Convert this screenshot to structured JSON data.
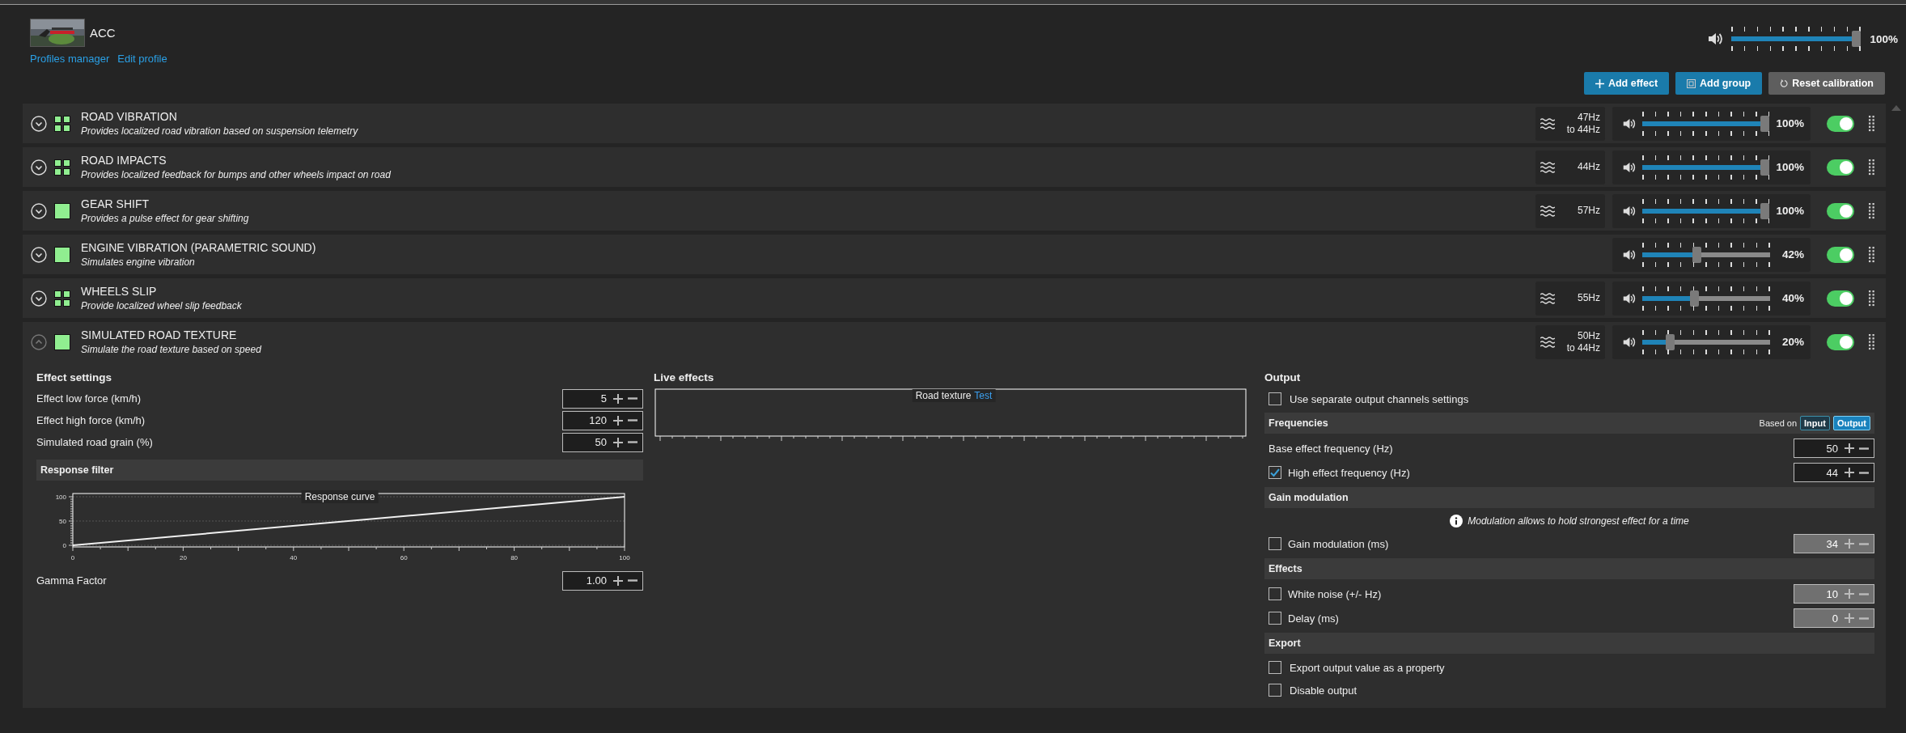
{
  "profile": {
    "thumbnail": {
      "kind": "picture"
    },
    "name": "ACC",
    "links": [
      "Profiles manager",
      "Edit profile"
    ]
  },
  "master_volume": {
    "level": 1.0,
    "reading": "100%"
  },
  "toolbar": [
    {
      "kind": "add",
      "label": "Add effect"
    },
    {
      "kind": "group",
      "label": "Add group"
    },
    {
      "kind": "reset",
      "label": "Reset calibration"
    }
  ],
  "effects": [
    {
      "kind": "group",
      "title": "ROAD VIBRATION",
      "description": "Provides localized road vibration based on suspension telemetry",
      "expanded": false,
      "frequency": [
        "47Hz",
        "to 44Hz"
      ],
      "level": 1.0,
      "reading": "100%",
      "on": true
    },
    {
      "kind": "group",
      "title": "ROAD IMPACTS",
      "description": "Provides localized feedback for bumps and other wheels impact on road",
      "expanded": false,
      "frequency": [
        "44Hz"
      ],
      "level": 1.0,
      "reading": "100%",
      "on": true
    },
    {
      "kind": "single",
      "title": "GEAR SHIFT",
      "description": "Provides a pulse effect for gear shifting",
      "expanded": false,
      "frequency": [
        "57Hz"
      ],
      "level": 1.0,
      "reading": "100%",
      "on": true
    },
    {
      "kind": "single",
      "title": "ENGINE VIBRATION (PARAMETRIC SOUND)",
      "description": "Simulates engine vibration",
      "expanded": false,
      "level": 0.42,
      "reading": "42%",
      "on": true
    },
    {
      "kind": "group",
      "title": "WHEELS SLIP",
      "description": "Provide localized wheel slip feedback",
      "expanded": false,
      "frequency": [
        "55Hz"
      ],
      "level": 0.4,
      "reading": "40%",
      "on": true
    },
    {
      "kind": "single",
      "title": "SIMULATED ROAD TEXTURE",
      "description": "Simulate the road texture based on speed",
      "expanded": true,
      "frequency": [
        "50Hz",
        "to 44Hz"
      ],
      "level": 0.2,
      "reading": "20%",
      "on": true,
      "details": {
        "settings": {
          "title": "Effect settings",
          "fields": [
            {
              "label": "Effect low force (km/h)",
              "value": "5"
            },
            {
              "label": "Effect high force (km/h)",
              "value": "120"
            },
            {
              "label": "Simulated road grain (%)",
              "value": "50"
            }
          ],
          "response_filter": {
            "title": "Response filter",
            "chart_data": {
              "type": "line",
              "title": "Response curve",
              "x": [
                0,
                100
              ],
              "values": [
                0,
                100
              ],
              "xlim": [
                0,
                100
              ],
              "ylim": [
                0,
                100
              ],
              "xticks": [
                0,
                20,
                40,
                60,
                80,
                100
              ],
              "yticks": [
                0,
                50,
                100
              ]
            }
          },
          "gamma": {
            "label": "Gamma Factor",
            "value": "1.00"
          }
        },
        "live": {
          "title": "Live effects",
          "chart_title": "Road texture",
          "link": "Test"
        },
        "output": {
          "title": "Output",
          "rows": [
            {
              "kind": "check",
              "label": "Use separate output channels settings",
              "checked": false
            }
          ],
          "sections": [
            {
              "title": "Frequencies",
              "based_on": {
                "label": "Based on",
                "options": [
                  {
                    "label": "Input",
                    "selected": false
                  },
                  {
                    "label": "Output",
                    "selected": true
                  }
                ]
              },
              "rows": [
                {
                  "kind": "field",
                  "label": "Base effect frequency (Hz)",
                  "value": "50",
                  "disabled": false
                },
                {
                  "kind": "check_field",
                  "label": "High effect frequency (Hz)",
                  "checked": true,
                  "value": "44",
                  "disabled": false
                }
              ]
            },
            {
              "title": "Gain modulation",
              "note": "Modulation allows to hold strongest effect for a time",
              "rows": [
                {
                  "kind": "check_field",
                  "label": "Gain modulation (ms)",
                  "checked": false,
                  "value": "34",
                  "disabled": true
                }
              ]
            },
            {
              "title": "Effects",
              "rows": [
                {
                  "kind": "check_field",
                  "label": "White noise (+/- Hz)",
                  "checked": false,
                  "value": "10",
                  "disabled": true
                },
                {
                  "kind": "check_field",
                  "label": "Delay (ms)",
                  "checked": false,
                  "value": "0",
                  "disabled": true
                }
              ]
            },
            {
              "title": "Export",
              "rows": [
                {
                  "kind": "check",
                  "label": "Export output value as a property",
                  "checked": false
                },
                {
                  "kind": "check",
                  "label": "Disable output",
                  "checked": false
                }
              ]
            }
          ]
        }
      }
    }
  ]
}
